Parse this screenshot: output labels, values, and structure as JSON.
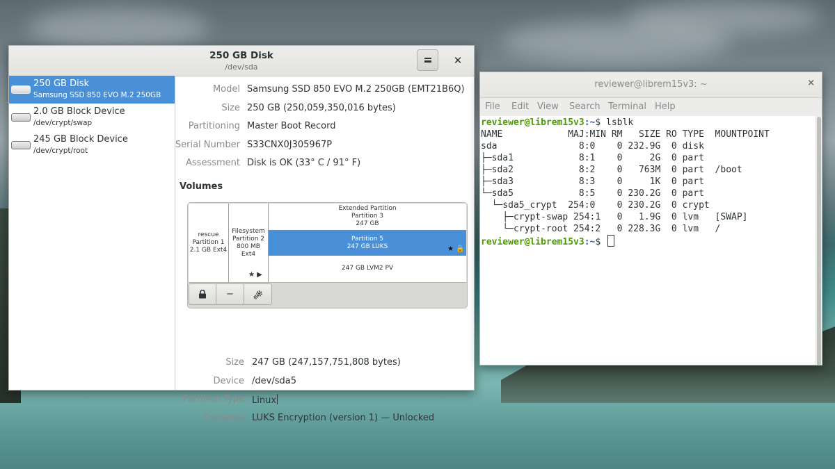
{
  "disks_window": {
    "title": "250 GB Disk",
    "subtitle": "/dev/sda",
    "menu_icon": "hamburger-menu-icon",
    "close_label": "✕",
    "sidebar": [
      {
        "name": "250 GB Disk",
        "sub": "Samsung SSD 850 EVO M.2 250GB",
        "selected": true
      },
      {
        "name": "2.0 GB Block Device",
        "sub": "/dev/crypt/swap",
        "selected": false
      },
      {
        "name": "245 GB Block Device",
        "sub": "/dev/crypt/root",
        "selected": false
      }
    ],
    "drive_props": [
      {
        "label": "Model",
        "value": "Samsung SSD 850 EVO M.2 250GB (EMT21B6Q)"
      },
      {
        "label": "Size",
        "value": "250 GB (250,059,350,016 bytes)"
      },
      {
        "label": "Partitioning",
        "value": "Master Boot Record"
      },
      {
        "label": "Serial Number",
        "value": "S33CNX0J305967P"
      },
      {
        "label": "Assessment",
        "value": "Disk is OK (33° C / 91° F)"
      }
    ],
    "volumes_heading": "Volumes",
    "volume_map": {
      "p1": [
        "rescue",
        "Partition 1",
        "2.1 GB Ext4"
      ],
      "p2": [
        "Filesystem",
        "Partition 2",
        "800 MB Ext4"
      ],
      "ext": [
        "Extended Partition",
        "Partition 3",
        "247 GB"
      ],
      "p5": [
        "Partition 5",
        "247 GB LUKS"
      ],
      "lvm": "247 GB LVM2 PV",
      "p2_icons": "★ ▶",
      "p5_icons": "★ 🔒"
    },
    "toolbar": {
      "lock": "lock-icon",
      "minus": "−",
      "gears": "gears-icon"
    },
    "volume_props": [
      {
        "label": "Size",
        "value": "247 GB (247,157,751,808 bytes)"
      },
      {
        "label": "Device",
        "value": "/dev/sda5"
      },
      {
        "label": "Partition Type",
        "value": "Linux"
      },
      {
        "label": "Contents",
        "value": "LUKS Encryption (version 1) — Unlocked"
      }
    ]
  },
  "terminal": {
    "title": "reviewer@librem15v3: ~",
    "close_label": "×",
    "menu": [
      "File",
      "Edit",
      "View",
      "Search",
      "Terminal",
      "Help"
    ],
    "prompt_user": "reviewer@librem15v3",
    "prompt_path": ":~",
    "command": "$ lsblk",
    "output": [
      "NAME            MAJ:MIN RM   SIZE RO TYPE  MOUNTPOINT",
      "sda               8:0    0 232.9G  0 disk",
      "├─sda1            8:1    0     2G  0 part",
      "├─sda2            8:2    0   763M  0 part  /boot",
      "├─sda3            8:3    0     1K  0 part",
      "└─sda5            8:5    0 230.2G  0 part",
      "  └─sda5_crypt  254:0    0 230.2G  0 crypt",
      "    ├─crypt-swap 254:1   0   1.9G  0 lvm   [SWAP]",
      "    └─crypt-root 254:2   0 228.3G  0 lvm   /"
    ],
    "final_prompt": "$ "
  }
}
